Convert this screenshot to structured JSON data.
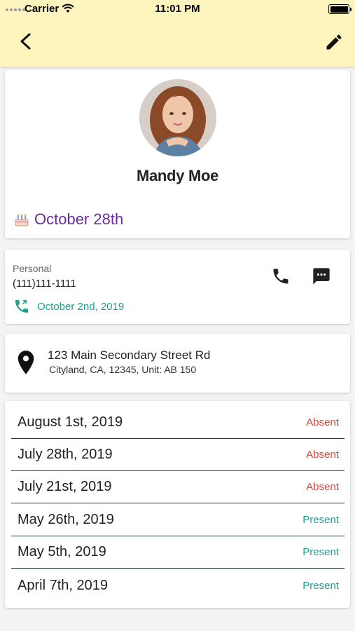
{
  "status_bar": {
    "carrier": "Carrier",
    "time": "11:01 PM"
  },
  "nav": {
    "back_icon": "chevron-left-icon",
    "edit_icon": "pencil-icon"
  },
  "profile": {
    "name": "Mandy Moe",
    "birthday": "October 28th",
    "birthday_icon": "birthday-cake-icon"
  },
  "contact": {
    "phone_type": "Personal",
    "phone_number": "(111)111-1111",
    "last_call_date": "October 2nd, 2019",
    "call_icon": "phone-icon",
    "message_icon": "message-icon"
  },
  "address": {
    "line1": "123 Main Secondary Street Rd",
    "line2": "Cityland, CA, 12345, Unit: AB 150"
  },
  "attendance": [
    {
      "date": "August 1st, 2019",
      "status": "Absent"
    },
    {
      "date": "July 28th, 2019",
      "status": "Absent"
    },
    {
      "date": "July 21st, 2019",
      "status": "Absent"
    },
    {
      "date": "May 26th, 2019",
      "status": "Present"
    },
    {
      "date": "May 5th, 2019",
      "status": "Present"
    },
    {
      "date": "April 7th, 2019",
      "status": "Present"
    }
  ],
  "colors": {
    "header_bg": "#fdf4be",
    "birthday_text": "#6c2d9c",
    "teal": "#1fa18f",
    "absent": "#e2463b",
    "present": "#1fa18f"
  }
}
